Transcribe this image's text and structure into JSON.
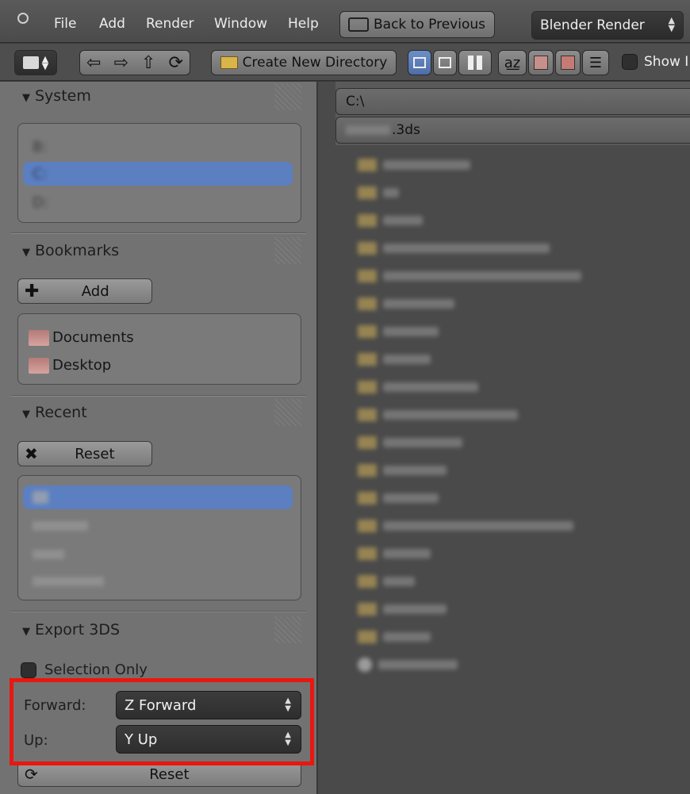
{
  "menubar": {
    "items": [
      "File",
      "Add",
      "Render",
      "Window",
      "Help"
    ],
    "back_button": "Back to Previous",
    "render_engine": "Blender Render"
  },
  "toolbar": {
    "create_dir": "Create New Directory",
    "show_label": "Show I"
  },
  "system": {
    "title": "System",
    "drives": [
      "B:",
      "C:",
      "D:"
    ]
  },
  "bookmarks": {
    "title": "Bookmarks",
    "add_label": "Add",
    "items": [
      "Documents",
      "Desktop"
    ]
  },
  "recent": {
    "title": "Recent",
    "reset_label": "Reset"
  },
  "export": {
    "title": "Export 3DS",
    "selection_only": "Selection Only",
    "forward_label": "Forward:",
    "forward_value": "Z Forward",
    "up_label": "Up:",
    "up_value": "Y Up",
    "reset_label": "Reset"
  },
  "filebrowser": {
    "directory": "C:\\",
    "filename_suffix": ".3ds",
    "folder_count_note": ""
  },
  "colors": {
    "selection": "#5b7fc1",
    "highlight": "#e8170f"
  }
}
